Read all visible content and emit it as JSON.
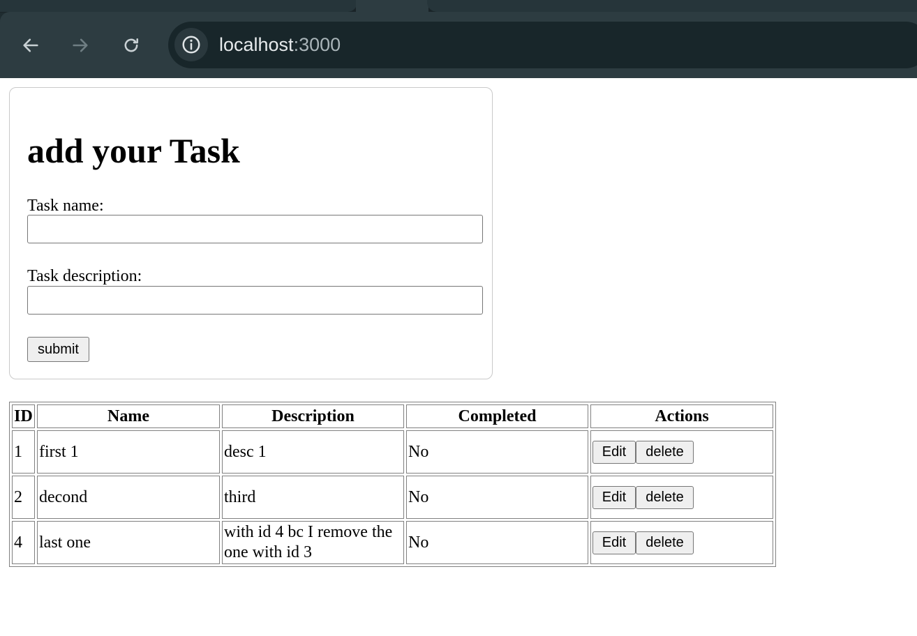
{
  "browser": {
    "url_host": "localhost",
    "url_port": ":3000",
    "icons": {
      "back": "arrow-left-icon",
      "forward": "arrow-right-icon",
      "reload": "reload-icon",
      "site_info": "info-icon"
    }
  },
  "form": {
    "heading": "add your Task",
    "name_label": "Task name:",
    "name_value": "",
    "description_label": "Task description:",
    "description_value": "",
    "submit_label": "submit"
  },
  "table": {
    "headers": [
      "ID",
      "Name",
      "Description",
      "Completed",
      "Actions"
    ],
    "rows": [
      {
        "id": "1",
        "name": "first 1",
        "description": "desc 1",
        "completed": "No",
        "edit": "Edit",
        "delete": "delete"
      },
      {
        "id": "2",
        "name": "decond",
        "description": "third",
        "completed": "No",
        "edit": "Edit",
        "delete": "delete"
      },
      {
        "id": "4",
        "name": "last one",
        "description": "with id 4 bc I remove the one with id 3",
        "completed": "No",
        "edit": "Edit",
        "delete": "delete"
      }
    ]
  }
}
